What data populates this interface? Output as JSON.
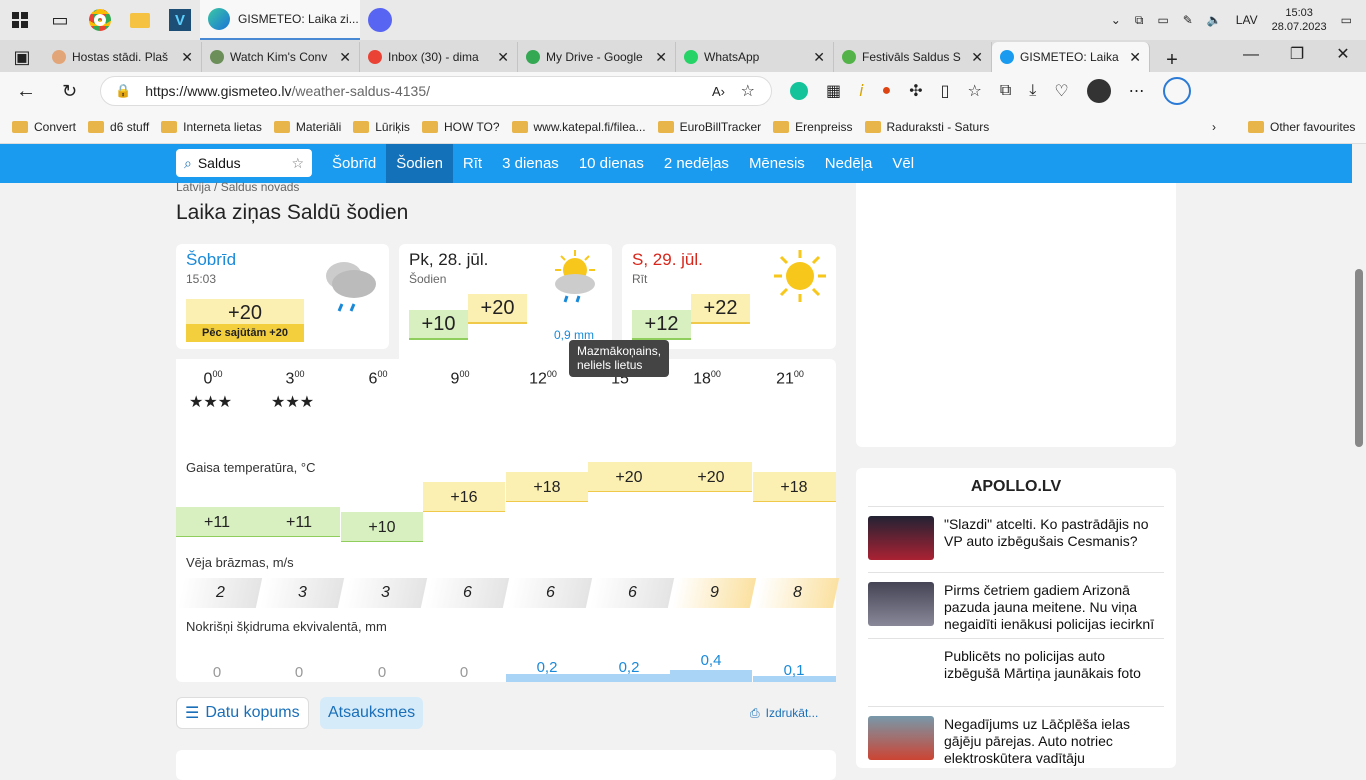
{
  "taskbar": {
    "active_title": "GISMETEO: Laika zi...",
    "lang": "LAV",
    "time": "15:03",
    "date": "28.07.2023"
  },
  "tabs": [
    {
      "title": "Hostas stādi. Plaš",
      "color": "#e2a577"
    },
    {
      "title": "Watch Kim's Conv",
      "color": "#6c8f5a"
    },
    {
      "title": "Inbox (30) - dima",
      "color": "#ea4335"
    },
    {
      "title": "My Drive - Google",
      "color": "#34a853"
    },
    {
      "title": "WhatsApp",
      "color": "#25d366"
    },
    {
      "title": "Festivāls Saldus S",
      "color": "#53b348"
    },
    {
      "title": "GISMETEO: Laika",
      "color": "#1a9bef"
    }
  ],
  "url": {
    "host": "https://www.gismeteo.lv",
    "path": "/weather-saldus-4135/"
  },
  "bookmarks": [
    "Convert",
    "d6 stuff",
    "Interneta lietas",
    "Materiāli",
    "Lūriķis",
    "HOW TO?",
    "www.katepal.fi/filea...",
    "EuroBillTracker",
    "Erenpreiss",
    "Raduraksti - Saturs"
  ],
  "other_fav": "Other favourites",
  "nav": {
    "search": "Saldus",
    "links": [
      "Šobrīd",
      "Šodien",
      "Rīt",
      "3 dienas",
      "10 dienas",
      "2 nedēļas",
      "Mēnesis",
      "Nedēļa",
      "Vēl"
    ]
  },
  "crumb": "Latvija / Saldus novads",
  "title": "Laika ziņas Saldū šodien",
  "now": {
    "label": "Šobrīd",
    "time": "15:03",
    "temp": "+20",
    "feels": "Pēc sajūtām +20"
  },
  "today": {
    "label": "Pk, 28. jūl.",
    "sub": "Šodien",
    "min": "+10",
    "max": "+20",
    "precip": "0,9 mm"
  },
  "tomorrow": {
    "label": "S, 29. jūl.",
    "sub": "Rīt",
    "min": "+12",
    "max": "+22"
  },
  "tooltip": "Mazmākoņains, neliels lietus",
  "hours": [
    {
      "h": "0",
      "temp": "+11",
      "wind": "2",
      "precip": "0",
      "icon": "night"
    },
    {
      "h": "3",
      "temp": "+11",
      "wind": "3",
      "precip": "0",
      "icon": "night"
    },
    {
      "h": "6",
      "temp": "+10",
      "wind": "3",
      "precip": "0",
      "icon": "sun"
    },
    {
      "h": "9",
      "temp": "+16",
      "wind": "6",
      "precip": "0",
      "icon": "cloud"
    },
    {
      "h": "12",
      "temp": "+18",
      "wind": "6",
      "precip": "0,2",
      "icon": "cloudrain"
    },
    {
      "h": "15",
      "temp": "+20",
      "wind": "6",
      "precip": "0,2",
      "icon": "sunrain"
    },
    {
      "h": "18",
      "temp": "+20",
      "wind": "9",
      "precip": "0,4",
      "icon": "sunrain"
    },
    {
      "h": "21",
      "temp": "+18",
      "wind": "8",
      "precip": "0,1",
      "icon": "sunrain"
    }
  ],
  "labels": {
    "temp": "Gaisa temperatūra, °C",
    "wind": "Vēja brāzmas, m/s",
    "precip": "Nokrišņi šķidruma ekvivalentā, mm"
  },
  "buttons": {
    "data": "Datu kopums",
    "feedback": "Atsauksmes",
    "print": "Izdrukāt..."
  },
  "news": {
    "title": "APOLLO.LV",
    "items": [
      "\"Slazdi\" atcelti. Ko pastrādājis no VP auto izbēgušais Cesmanis?",
      "Pirms četriem gadiem Arizonā pazuda jauna meitene. Nu viņa negaidīti ienākusi policijas iecirknī",
      "Publicēts no policijas auto izbēgušā Mārtiņa jaunākais foto",
      "Negadījums uz Lāčplēša ielas gājēju pārejas. Auto notriec elektroskūtera vadītāju"
    ]
  }
}
